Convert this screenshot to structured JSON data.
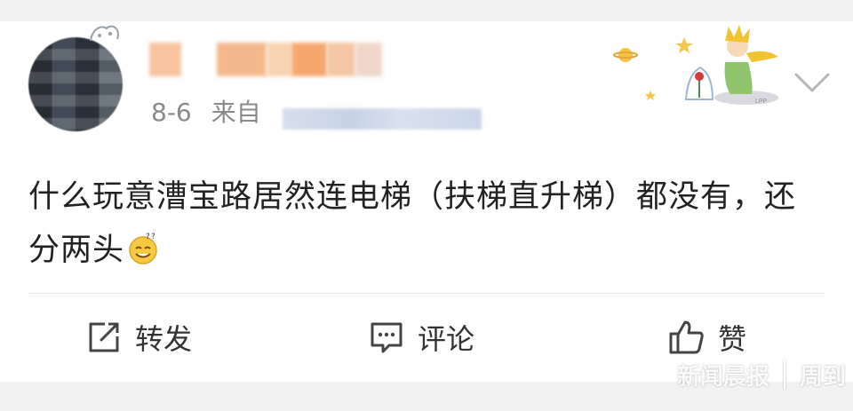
{
  "post": {
    "date": "8-6",
    "source_prefix": "来自",
    "text_line": "什么玩意漕宝路居然连电梯（扶梯直升梯）都没有，还分两头"
  },
  "icons": {
    "repost": "share-square-icon",
    "comment": "comment-icon",
    "like": "thumbs-up-icon",
    "more": "chevron-down-icon"
  },
  "actions": {
    "repost_label": "转发",
    "comment_label": "评论",
    "like_label": "赞"
  },
  "watermark": {
    "left": "新闻晨报",
    "right": "周到"
  },
  "colors": {
    "background": "#f2f2f2",
    "card": "#ffffff",
    "meta_text": "#8a8a8a",
    "body_text": "#222222"
  }
}
